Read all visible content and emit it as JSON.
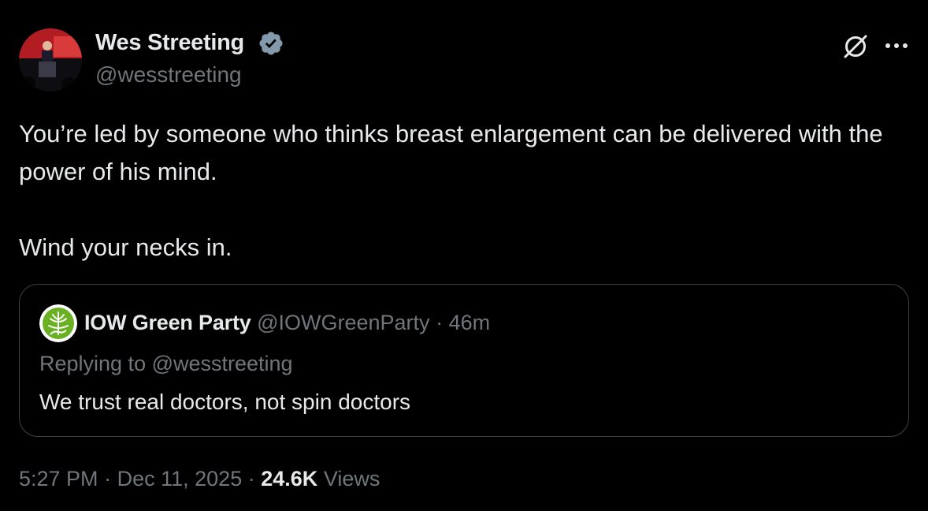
{
  "author": {
    "name": "Wes Streeting",
    "handle": "@wesstreeting",
    "verified": true
  },
  "tweet": {
    "text": "You’re led by someone who thinks breast enlargement can be delivered with the power of his mind.\n\nWind your necks in."
  },
  "quoted": {
    "name": "IOW Green Party",
    "handle": "@IOWGreenParty",
    "separator": "·",
    "time": "46m",
    "replying_to": "Replying to @wesstreeting",
    "text": "We trust real doctors, not spin doctors"
  },
  "meta": {
    "time": "5:27 PM",
    "separator": "·",
    "date": "Dec 11, 2025",
    "views_count": "24.6K",
    "views_label": "Views"
  },
  "icons": {
    "verified": "verified-badge-icon",
    "grok": "grok-icon",
    "more": "more-icon"
  },
  "colors": {
    "background": "#000000",
    "text_primary": "#e7e9ea",
    "text_secondary": "#71767b",
    "border": "#3e4144",
    "verified_badge": "#829aab",
    "green_party": "#6ab023"
  }
}
